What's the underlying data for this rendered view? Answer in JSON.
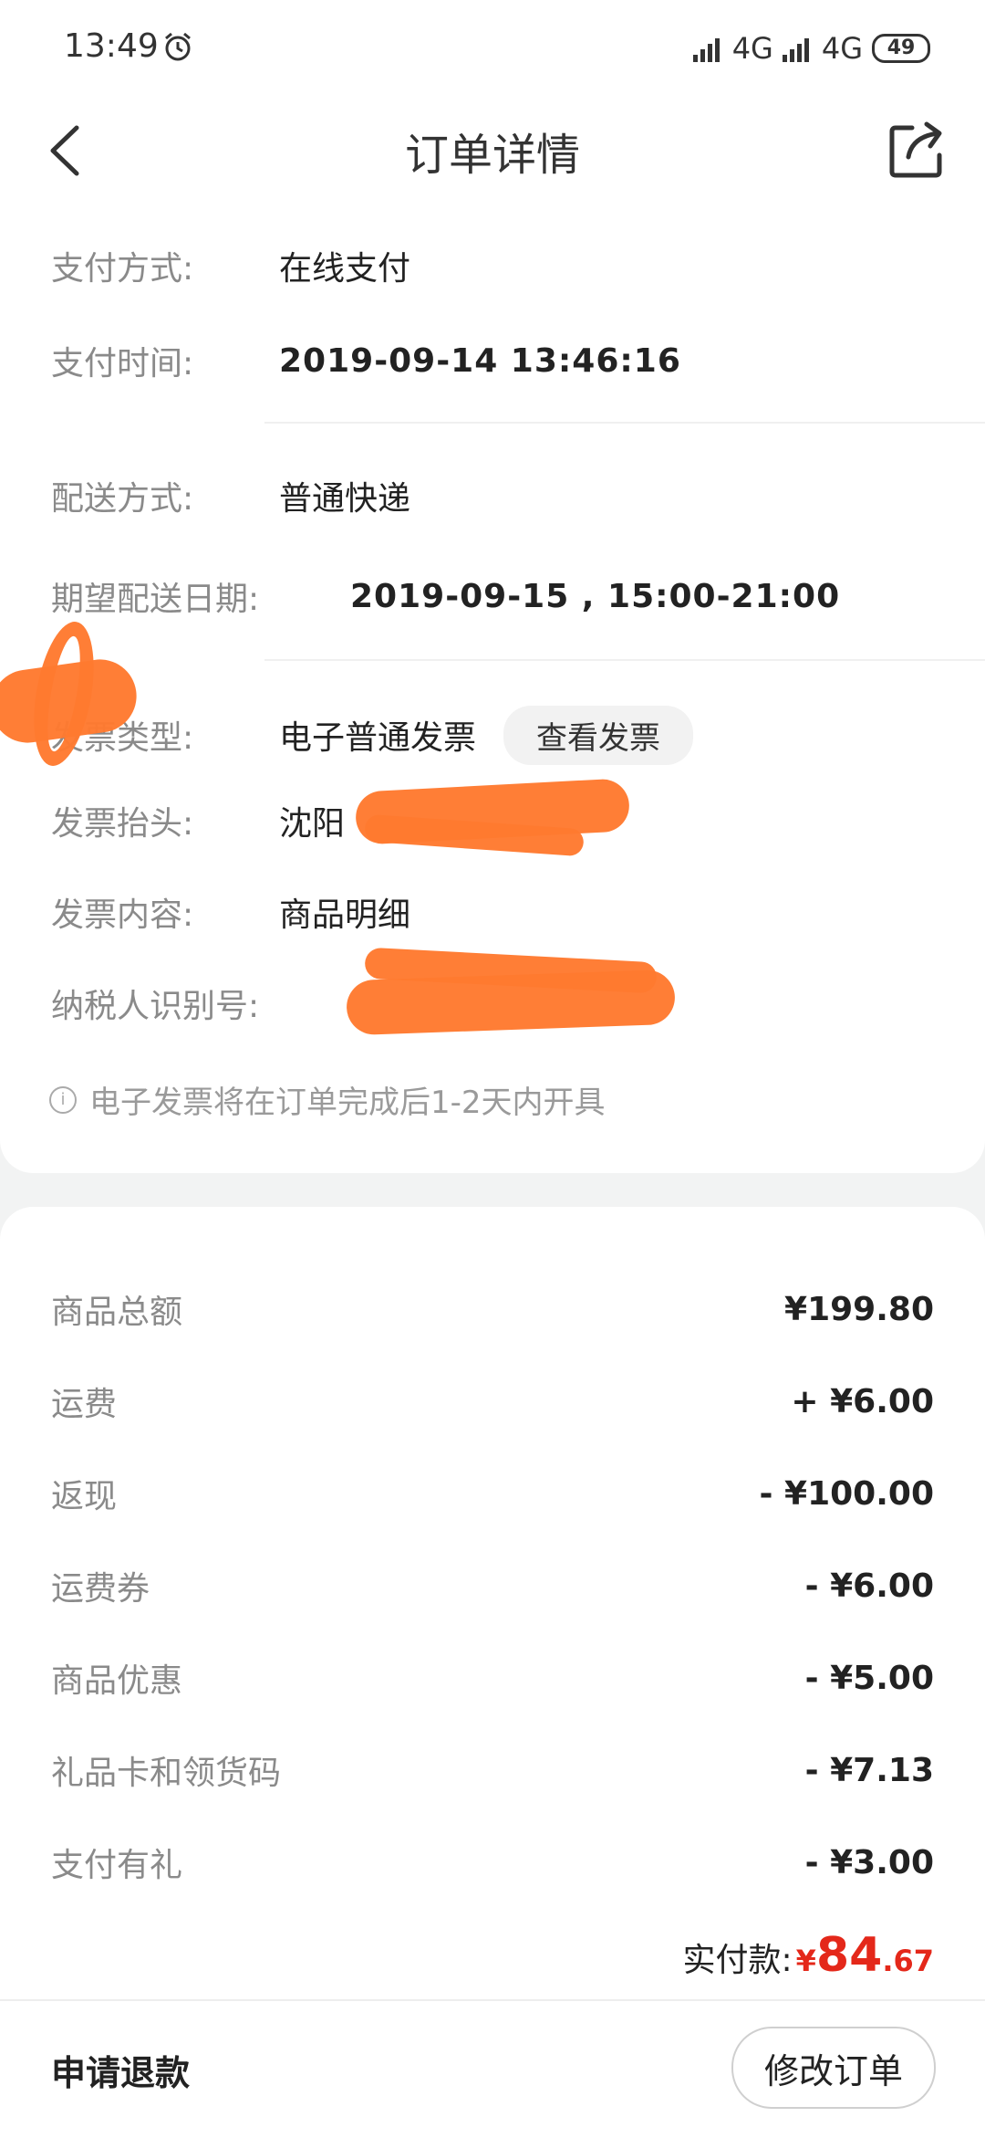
{
  "status_bar": {
    "time": "13:49",
    "network1": "4G",
    "network2": "4G",
    "battery": "49"
  },
  "header": {
    "title": "订单详情"
  },
  "payment": {
    "method_label": "支付方式:",
    "method_value": "在线支付",
    "time_label": "支付时间:",
    "time_value": "2019-09-14 13:46:16"
  },
  "delivery": {
    "method_label": "配送方式:",
    "method_value": "普通快递",
    "date_label": "期望配送日期:",
    "date_value": "2019-09-15 , 15:00-21:00"
  },
  "invoice": {
    "type_label": "发票类型:",
    "type_value": "电子普通发票",
    "view_button": "查看发票",
    "title_label": "发票抬头:",
    "title_value": "沈阳",
    "content_label": "发票内容:",
    "content_value": "商品明细",
    "taxid_label": "纳税人识别号:",
    "note": "电子发票将在订单完成后1-2天内开具"
  },
  "amounts": {
    "rows": [
      {
        "label": "商品总额",
        "value": "¥199.80"
      },
      {
        "label": "运费",
        "value": "+ ¥6.00"
      },
      {
        "label": "返现",
        "value": "- ¥100.00"
      },
      {
        "label": "运费券",
        "value": "- ¥6.00"
      },
      {
        "label": "商品优惠",
        "value": "- ¥5.00"
      },
      {
        "label": "礼品卡和领货码",
        "value": "- ¥7.13"
      },
      {
        "label": "支付有礼",
        "value": "- ¥3.00"
      }
    ],
    "total_label": "实付款:",
    "total_currency": "¥",
    "total_int": "84",
    "total_dec": ".67"
  },
  "bottom": {
    "refund": "申请退款",
    "modify": "修改订单"
  },
  "colors": {
    "accent_red": "#e4281a",
    "redaction": "#ff7a2f"
  }
}
